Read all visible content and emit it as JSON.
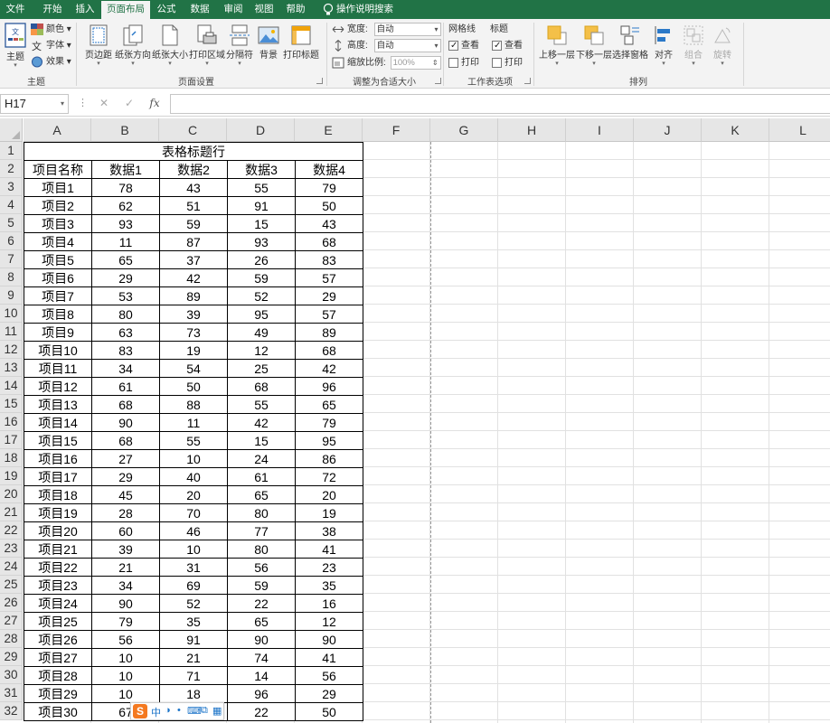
{
  "tabs": [
    {
      "label": "文件",
      "active": false
    },
    {
      "label": "开始",
      "active": false
    },
    {
      "label": "插入",
      "active": false
    },
    {
      "label": "页面布局",
      "active": true
    },
    {
      "label": "公式",
      "active": false
    },
    {
      "label": "数据",
      "active": false
    },
    {
      "label": "审阅",
      "active": false
    },
    {
      "label": "视图",
      "active": false
    },
    {
      "label": "帮助",
      "active": false
    }
  ],
  "tell_me": "操作说明搜索",
  "ribbon": {
    "theme": {
      "themes_label": "主题",
      "colors_label": "颜色",
      "fonts_label": "字体",
      "effects_label": "效果",
      "group_label": "主题"
    },
    "page_setup": {
      "margins": "页边距",
      "orientation": "纸张方向",
      "size": "纸张大小",
      "print_area": "打印区域",
      "breaks": "分隔符",
      "background": "背景",
      "print_titles": "打印标题",
      "group_label": "页面设置"
    },
    "scale_to_fit": {
      "width_label": "宽度:",
      "width_value": "自动",
      "height_label": "高度:",
      "height_value": "自动",
      "scale_label": "缩放比例:",
      "scale_value": "100%",
      "group_label": "调整为合适大小"
    },
    "sheet_options": {
      "gridlines_label": "网格线",
      "headings_label": "标题",
      "view_label": "查看",
      "print_label": "打印",
      "gridlines_view": true,
      "gridlines_print": false,
      "headings_view": true,
      "headings_print": false,
      "group_label": "工作表选项"
    },
    "arrange": {
      "bring_forward": "上移一层",
      "send_backward": "下移一层",
      "selection_pane": "选择窗格",
      "align": "对齐",
      "group": "组合",
      "rotate": "旋转",
      "group_label": "排列"
    }
  },
  "formula_bar": {
    "name_box": "H17",
    "cancel": "✕",
    "enter": "✓",
    "fx": "fx",
    "content": ""
  },
  "columns": [
    "A",
    "B",
    "C",
    "D",
    "E",
    "F",
    "G",
    "H",
    "I",
    "J",
    "K",
    "L"
  ],
  "sheet": {
    "title": "表格标题行",
    "headers": [
      "项目名称",
      "数据1",
      "数据2",
      "数据3",
      "数据4"
    ],
    "rows": [
      [
        "项目1",
        "78",
        "43",
        "55",
        "79"
      ],
      [
        "项目2",
        "62",
        "51",
        "91",
        "50"
      ],
      [
        "项目3",
        "93",
        "59",
        "15",
        "43"
      ],
      [
        "项目4",
        "11",
        "87",
        "93",
        "68"
      ],
      [
        "项目5",
        "65",
        "37",
        "26",
        "83"
      ],
      [
        "项目6",
        "29",
        "42",
        "59",
        "57"
      ],
      [
        "项目7",
        "53",
        "89",
        "52",
        "29"
      ],
      [
        "项目8",
        "80",
        "39",
        "95",
        "57"
      ],
      [
        "项目9",
        "63",
        "73",
        "49",
        "89"
      ],
      [
        "项目10",
        "83",
        "19",
        "12",
        "68"
      ],
      [
        "项目11",
        "34",
        "54",
        "25",
        "42"
      ],
      [
        "项目12",
        "61",
        "50",
        "68",
        "96"
      ],
      [
        "项目13",
        "68",
        "88",
        "55",
        "65"
      ],
      [
        "项目14",
        "90",
        "11",
        "42",
        "79"
      ],
      [
        "项目15",
        "68",
        "55",
        "15",
        "95"
      ],
      [
        "项目16",
        "27",
        "10",
        "24",
        "86"
      ],
      [
        "项目17",
        "29",
        "40",
        "61",
        "72"
      ],
      [
        "项目18",
        "45",
        "20",
        "65",
        "20"
      ],
      [
        "项目19",
        "28",
        "70",
        "80",
        "19"
      ],
      [
        "项目20",
        "60",
        "46",
        "77",
        "38"
      ],
      [
        "项目21",
        "39",
        "10",
        "80",
        "41"
      ],
      [
        "项目22",
        "21",
        "31",
        "56",
        "23"
      ],
      [
        "项目23",
        "34",
        "69",
        "59",
        "35"
      ],
      [
        "项目24",
        "90",
        "52",
        "22",
        "16"
      ],
      [
        "项目25",
        "79",
        "35",
        "65",
        "12"
      ],
      [
        "项目26",
        "56",
        "91",
        "90",
        "90"
      ],
      [
        "项目27",
        "10",
        "21",
        "74",
        "41"
      ],
      [
        "项目28",
        "10",
        "71",
        "14",
        "56"
      ],
      [
        "项目29",
        "10",
        "18",
        "96",
        "29"
      ],
      [
        "项目30",
        "67",
        "",
        "22",
        "50"
      ]
    ]
  },
  "ime_toolbar": {
    "logo": "S",
    "mode": "中"
  },
  "colors": {
    "accent": "#217346",
    "ribbon_bg": "#f3f3f3",
    "header_bg": "#e6e6e6"
  }
}
